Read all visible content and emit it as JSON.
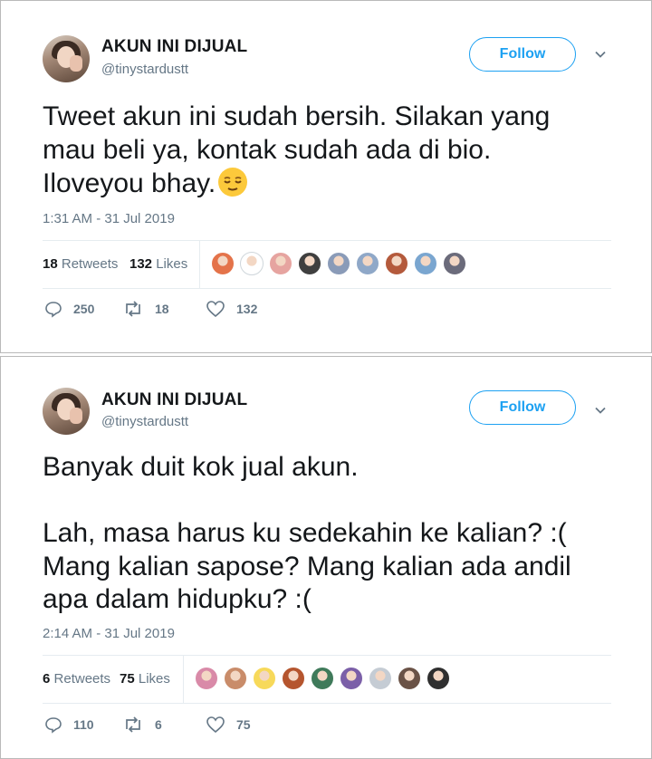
{
  "tweets": [
    {
      "name": "AKUN INI DIJUAL",
      "handle": "@tinystardustt",
      "follow_label": "Follow",
      "text": "Tweet akun ini sudah bersih. Silakan yang\nmau beli ya, kontak sudah ada di bio.\nIloveyou bhay.",
      "emoji": "relieved-face-emoji",
      "timestamp": "1:31 AM - 31 Jul 2019",
      "retweets_count": "18",
      "retweets_label": "Retweets",
      "likes_count": "132",
      "likes_label": "Likes",
      "liker_avatar_colors": [
        "#e4734a",
        "#ffffff",
        "#e6a4a0",
        "#3f3f3f",
        "#8a9bb8",
        "#8fa8c8",
        "#b45a3c",
        "#7aa6d0",
        "#6b6b7b"
      ],
      "replies": "250",
      "retweets_action": "18",
      "likes_action": "132"
    },
    {
      "name": "AKUN INI DIJUAL",
      "handle": "@tinystardustt",
      "follow_label": "Follow",
      "text": "Banyak duit kok jual akun.\n\nLah, masa harus ku sedekahin ke kalian? :(\nMang kalian sapose? Mang kalian ada andil\napa dalam hidupku? :(",
      "timestamp": "2:14 AM - 31 Jul 2019",
      "retweets_count": "6",
      "retweets_label": "Retweets",
      "likes_count": "75",
      "likes_label": "Likes",
      "liker_avatar_colors": [
        "#d98aa8",
        "#c98c6a",
        "#f7d95a",
        "#b5552e",
        "#3f7a5a",
        "#7b5fa8",
        "#c5ccd4",
        "#6a5246",
        "#2f2f2f"
      ],
      "replies": "110",
      "retweets_action": "6",
      "likes_action": "75"
    }
  ],
  "colors": {
    "accent": "#1da1f2",
    "secondary_text": "#657786",
    "divider": "#e6ecf0"
  }
}
